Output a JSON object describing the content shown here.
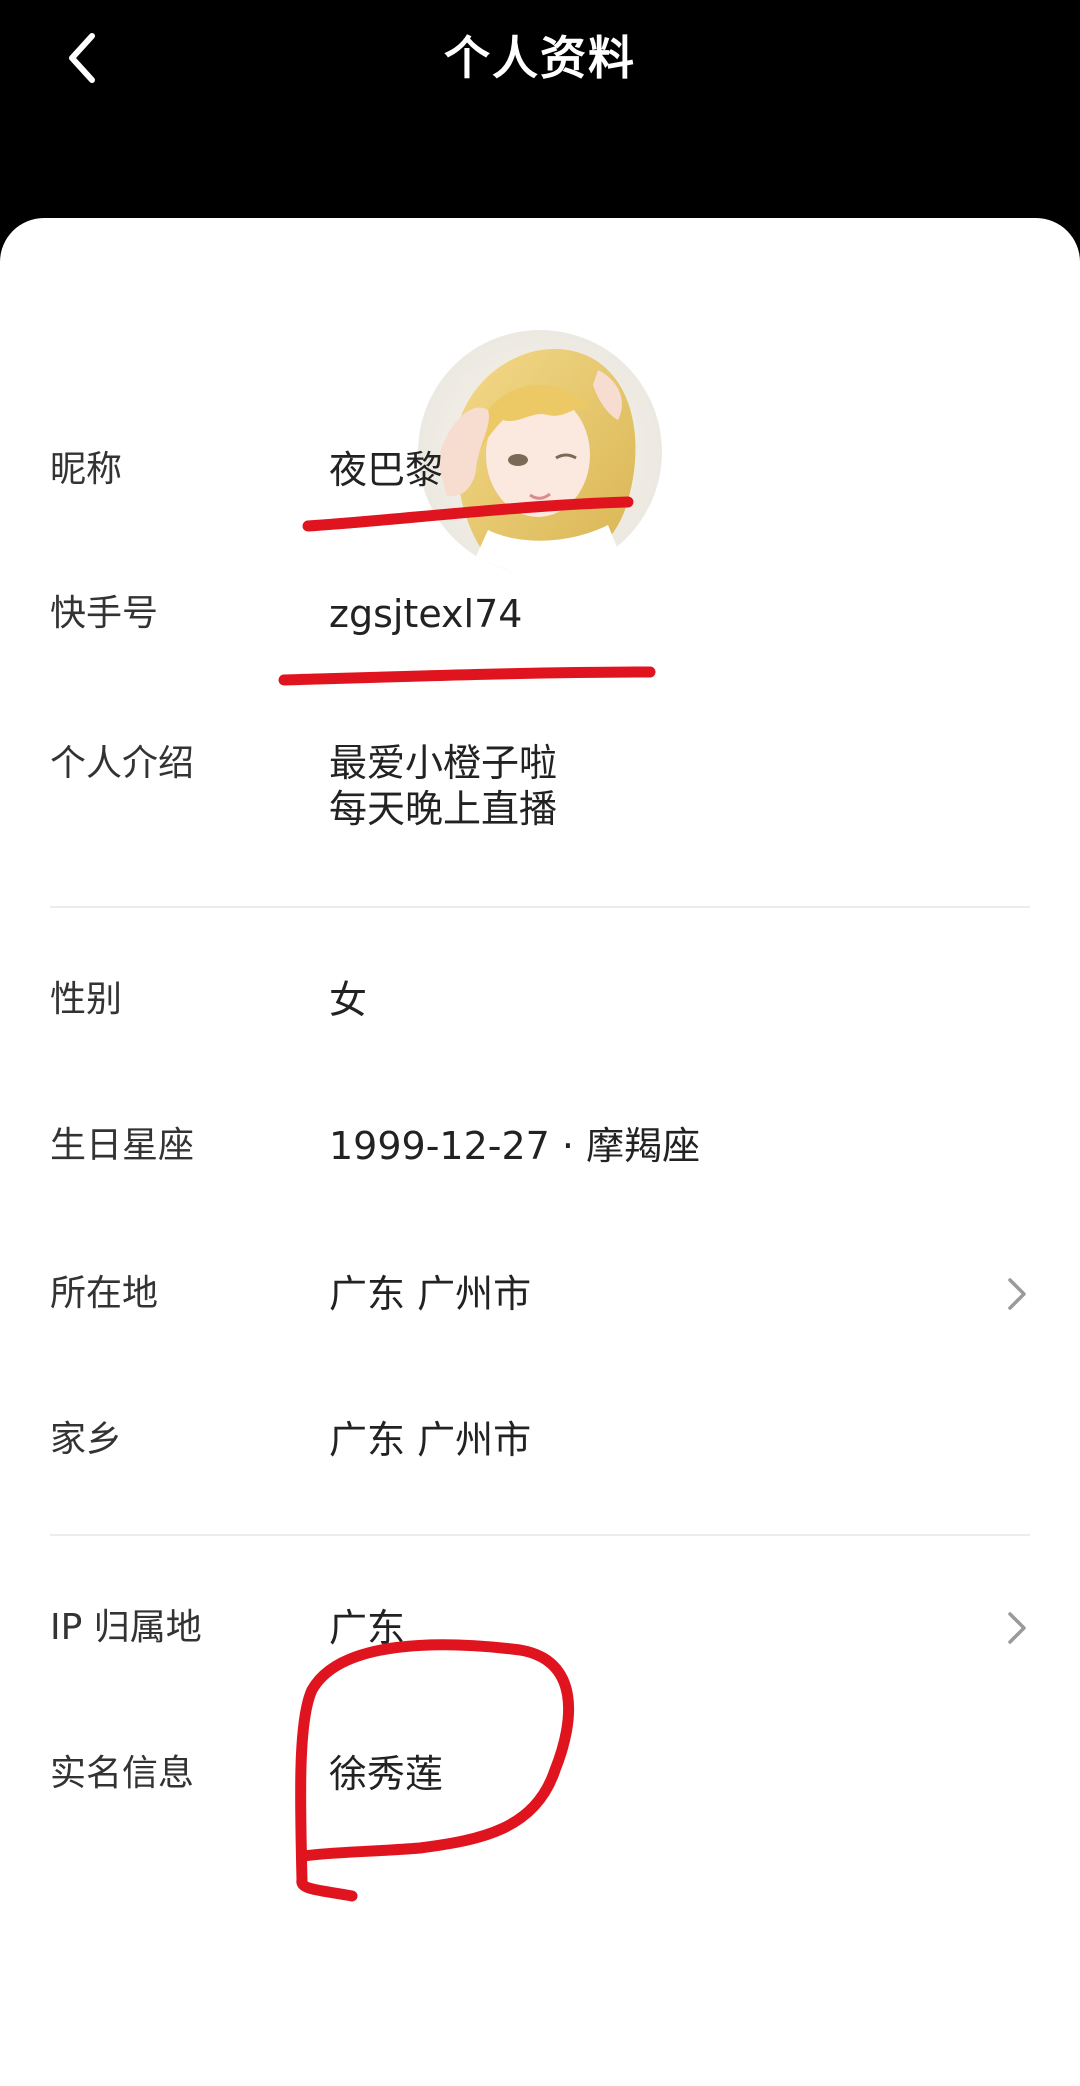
{
  "header": {
    "title": "个人资料",
    "back_icon": "chevron-left-icon"
  },
  "avatar": {
    "description_icon": "avatar-illustration"
  },
  "profile": {
    "nickname": {
      "label": "昵称",
      "value": "夜巴黎"
    },
    "kuaishou_id": {
      "label": "快手号",
      "value": "zgsjtexl74"
    },
    "intro": {
      "label": "个人介绍",
      "line1": "最爱小橙子啦",
      "line2": "每天晚上直播"
    },
    "gender": {
      "label": "性别",
      "value": "女"
    },
    "birthday": {
      "label": "生日星座",
      "value": "1999-12-27 · 摩羯座"
    },
    "location": {
      "label": "所在地",
      "value": "广东 广州市",
      "chevron_icon": "chevron-right-icon"
    },
    "hometown": {
      "label": "家乡",
      "value": "广东 广州市"
    },
    "ip": {
      "label": "IP 归属地",
      "value": "广东",
      "chevron_icon": "chevron-right-icon"
    },
    "realname": {
      "label": "实名信息",
      "value": "徐秀莲"
    }
  },
  "colors": {
    "header_bg": "#000000",
    "card_bg": "#ffffff",
    "annotation": "#e0141e",
    "divider": "#ececec"
  }
}
